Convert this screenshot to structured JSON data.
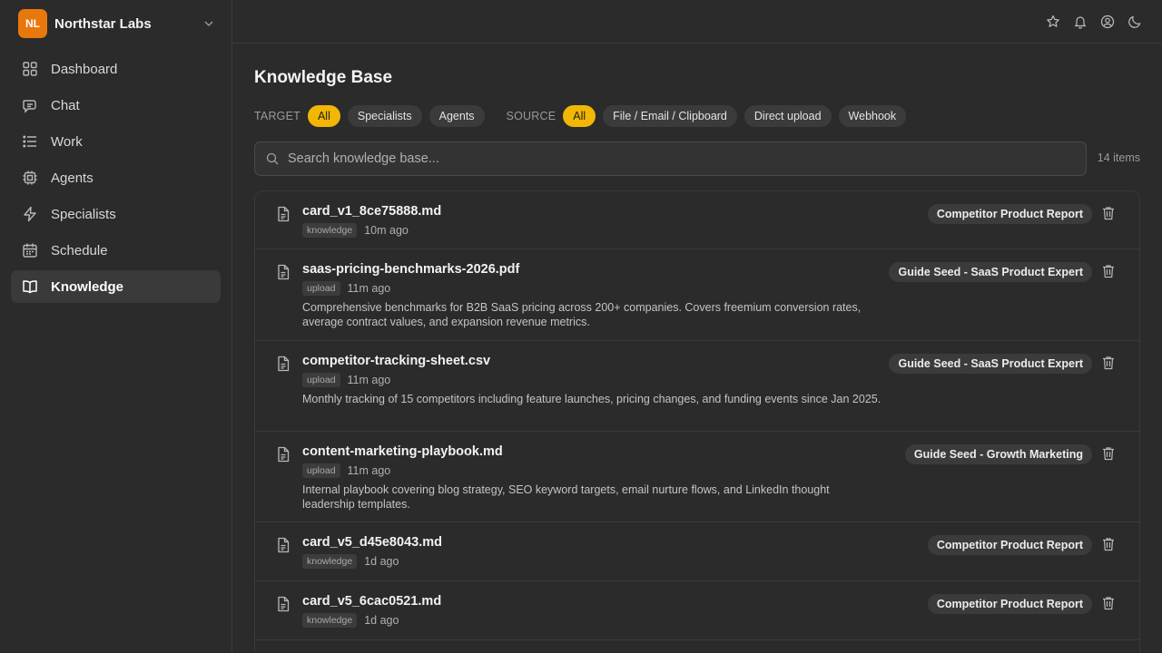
{
  "brand": {
    "initials": "NL",
    "name": "Northstar Labs"
  },
  "nav": [
    {
      "label": "Dashboard",
      "icon": "dashboard-icon"
    },
    {
      "label": "Chat",
      "icon": "chat-icon"
    },
    {
      "label": "Work",
      "icon": "list-icon"
    },
    {
      "label": "Agents",
      "icon": "cpu-icon"
    },
    {
      "label": "Specialists",
      "icon": "lightning-icon"
    },
    {
      "label": "Schedule",
      "icon": "calendar-icon"
    },
    {
      "label": "Knowledge",
      "icon": "book-icon",
      "active": true
    }
  ],
  "topbar": {
    "icons": [
      "star-icon",
      "bell-icon",
      "user-circle-icon",
      "moon-icon"
    ]
  },
  "page": {
    "title": "Knowledge Base"
  },
  "filters": {
    "target_label": "TARGET",
    "target_options": [
      "All",
      "Specialists",
      "Agents"
    ],
    "target_selected": "All",
    "source_label": "SOURCE",
    "source_options": [
      "All",
      "File / Email / Clipboard",
      "Direct upload",
      "Webhook"
    ],
    "source_selected": "All"
  },
  "search": {
    "placeholder": "Search knowledge base...",
    "value": ""
  },
  "item_count": "14 items",
  "items": [
    {
      "name": "card_v1_8ce75888.md",
      "badge": "knowledge",
      "age": "10m ago",
      "desc": "",
      "tag": "Competitor Product Report"
    },
    {
      "name": "saas-pricing-benchmarks-2026.pdf",
      "badge": "upload",
      "age": "11m ago",
      "desc": "Comprehensive benchmarks for B2B SaaS pricing across 200+ companies. Covers freemium conversion rates, average contract values, and expansion revenue metrics.",
      "tag": "Guide Seed - SaaS Product Expert"
    },
    {
      "name": "competitor-tracking-sheet.csv",
      "badge": "upload",
      "age": "11m ago",
      "desc": "Monthly tracking of 15 competitors including feature launches, pricing changes, and funding events since Jan 2025.",
      "tag": "Guide Seed - SaaS Product Expert"
    },
    {
      "name": "content-marketing-playbook.md",
      "badge": "upload",
      "age": "11m ago",
      "desc": "Internal playbook covering blog strategy, SEO keyword targets, email nurture flows, and LinkedIn thought leadership templates.",
      "tag": "Guide Seed - Growth Marketing"
    },
    {
      "name": "card_v5_d45e8043.md",
      "badge": "knowledge",
      "age": "1d ago",
      "desc": "",
      "tag": "Competitor Product Report"
    },
    {
      "name": "card_v5_6cac0521.md",
      "badge": "knowledge",
      "age": "1d ago",
      "desc": "",
      "tag": "Competitor Product Report"
    }
  ]
}
